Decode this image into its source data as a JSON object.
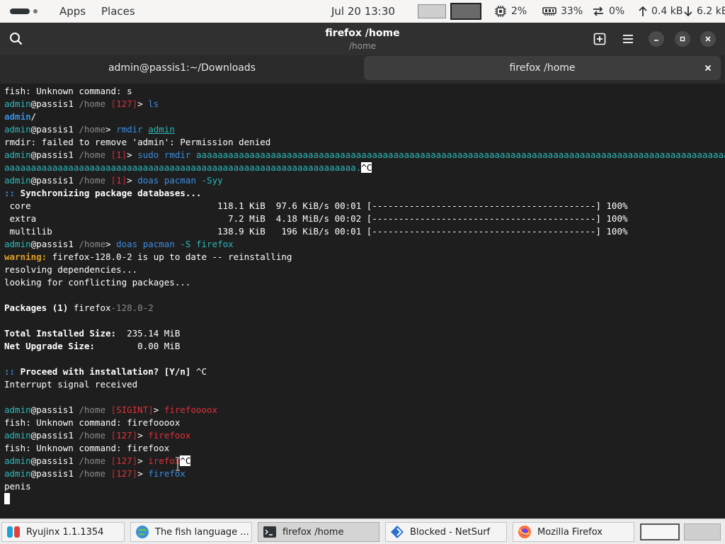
{
  "topbar": {
    "apps": "Apps",
    "places": "Places",
    "clock": "Jul 20  13:30",
    "cpu": "2%",
    "memory": "33%",
    "swap": "0%",
    "upload": "0.4 kB",
    "download": "6.2 kB"
  },
  "header": {
    "title": "firefox /home",
    "subtitle": "/home"
  },
  "tabs": [
    {
      "label": "admin@passis1:~/Downloads"
    },
    {
      "label": "firefox /home"
    }
  ],
  "terminal": {
    "lines": [
      [
        {
          "t": "fish: Unknown command: s"
        }
      ],
      [
        {
          "t": "admin",
          "c": "c-cyan"
        },
        {
          "t": "@passis1 "
        },
        {
          "t": "/home",
          "c": "c-dim"
        },
        {
          "t": " [",
          "c": "c-dimred"
        },
        {
          "t": "127",
          "c": "c-red"
        },
        {
          "t": "]",
          "c": "c-dimred"
        },
        {
          "t": "> "
        },
        {
          "t": "ls",
          "c": "c-blue"
        }
      ],
      [
        {
          "t": "admin",
          "c": "c-blue bold"
        },
        {
          "t": "/"
        }
      ],
      [
        {
          "t": "admin",
          "c": "c-cyan"
        },
        {
          "t": "@passis1 "
        },
        {
          "t": "/home",
          "c": "c-dim"
        },
        {
          "t": "> "
        },
        {
          "t": "rmdir",
          "c": "c-blue"
        },
        {
          "t": " "
        },
        {
          "t": "admin",
          "c": "c-cyan ul"
        }
      ],
      [
        {
          "t": "rmdir: failed to remove 'admin': Permission denied"
        }
      ],
      [
        {
          "t": "admin",
          "c": "c-cyan"
        },
        {
          "t": "@passis1 "
        },
        {
          "t": "/home",
          "c": "c-dim"
        },
        {
          "t": " [",
          "c": "c-dimred"
        },
        {
          "t": "1",
          "c": "c-red"
        },
        {
          "t": "]",
          "c": "c-dimred"
        },
        {
          "t": "> "
        },
        {
          "t": "sudo rmdir",
          "c": "c-blue"
        },
        {
          "t": " aaaaaaaaaaaaaaaaaaaaaaaaaaaaaaaaaaaaaaaaaaaaaaaaaaaaaaaaaaaaaaaaaaaaaaaaaaaaaaaaaaaaaaaaaaaaaaaaaaaaaaa",
          "c": "c-cyan"
        }
      ],
      [
        {
          "t": "aaaaaaaaaaaaaaaaaaaaaaaaaaaaaaaaaaaaaaaaaaaaaaaaaaaaaaaaaaaaaaaaaa.",
          "c": "c-cyan"
        },
        {
          "t": "^C",
          "c": "inv"
        }
      ],
      [
        {
          "t": "admin",
          "c": "c-cyan"
        },
        {
          "t": "@passis1 "
        },
        {
          "t": "/home",
          "c": "c-dim"
        },
        {
          "t": " [",
          "c": "c-dimred"
        },
        {
          "t": "1",
          "c": "c-red"
        },
        {
          "t": "]",
          "c": "c-dimred"
        },
        {
          "t": "> "
        },
        {
          "t": "doas pacman",
          "c": "c-blue"
        },
        {
          "t": " -Syy",
          "c": "c-cyan"
        }
      ],
      [
        {
          "t": "::",
          "c": "c-blue bold"
        },
        {
          "t": " Synchronizing package databases...",
          "c": "bold"
        }
      ],
      [
        {
          "t": " core                                   118.1 KiB  97.6 KiB/s 00:01 [------------------------------------------] 100%"
        }
      ],
      [
        {
          "t": " extra                                    7.2 MiB  4.18 MiB/s 00:02 [------------------------------------------] 100%"
        }
      ],
      [
        {
          "t": " multilib                               138.9 KiB   196 KiB/s 00:01 [------------------------------------------] 100%"
        }
      ],
      [
        {
          "t": "admin",
          "c": "c-cyan"
        },
        {
          "t": "@passis1 "
        },
        {
          "t": "/home",
          "c": "c-dim"
        },
        {
          "t": "> "
        },
        {
          "t": "doas pacman",
          "c": "c-blue"
        },
        {
          "t": " -S firefox",
          "c": "c-cyan"
        }
      ],
      [
        {
          "t": "warning:",
          "c": "c-yellow"
        },
        {
          "t": " firefox-128.0-2 is up to date -- reinstalling"
        }
      ],
      [
        {
          "t": "resolving dependencies..."
        }
      ],
      [
        {
          "t": "looking for conflicting packages..."
        }
      ],
      [
        {
          "t": ""
        }
      ],
      [
        {
          "t": "Packages (1)",
          "c": "bold"
        },
        {
          "t": " firefox"
        },
        {
          "t": "-128.0-2",
          "c": "c-dim"
        }
      ],
      [
        {
          "t": ""
        }
      ],
      [
        {
          "t": "Total Installed Size:",
          "c": "bold"
        },
        {
          "t": "  235.14 MiB"
        }
      ],
      [
        {
          "t": "Net Upgrade Size:",
          "c": "bold"
        },
        {
          "t": "        0.00 MiB"
        }
      ],
      [
        {
          "t": ""
        }
      ],
      [
        {
          "t": "::",
          "c": "c-blue bold"
        },
        {
          "t": " Proceed with installation? [Y/n]",
          "c": "bold"
        },
        {
          "t": " ^C"
        }
      ],
      [
        {
          "t": "Interrupt signal received"
        }
      ],
      [
        {
          "t": ""
        }
      ],
      [
        {
          "t": "admin",
          "c": "c-cyan"
        },
        {
          "t": "@passis1 "
        },
        {
          "t": "/home",
          "c": "c-dim"
        },
        {
          "t": " [",
          "c": "c-dimred"
        },
        {
          "t": "SIGINT",
          "c": "c-red"
        },
        {
          "t": "]",
          "c": "c-dimred"
        },
        {
          "t": "> "
        },
        {
          "t": "firefoooox",
          "c": "c-red"
        }
      ],
      [
        {
          "t": "fish: Unknown command: firefoooox"
        }
      ],
      [
        {
          "t": "admin",
          "c": "c-cyan"
        },
        {
          "t": "@passis1 "
        },
        {
          "t": "/home",
          "c": "c-dim"
        },
        {
          "t": " [",
          "c": "c-dimred"
        },
        {
          "t": "127",
          "c": "c-red"
        },
        {
          "t": "]",
          "c": "c-dimred"
        },
        {
          "t": "> "
        },
        {
          "t": "firefoox",
          "c": "c-red"
        }
      ],
      [
        {
          "t": "fish: Unknown command: firefoox"
        }
      ],
      [
        {
          "t": "admin",
          "c": "c-cyan"
        },
        {
          "t": "@passis1 "
        },
        {
          "t": "/home",
          "c": "c-dim"
        },
        {
          "t": " [",
          "c": "c-dimred"
        },
        {
          "t": "127",
          "c": "c-red"
        },
        {
          "t": "]",
          "c": "c-dimred"
        },
        {
          "t": "> "
        },
        {
          "t": "irefox",
          "c": "c-red"
        },
        {
          "t": "^C",
          "c": "inv"
        }
      ],
      [
        {
          "t": "admin",
          "c": "c-cyan"
        },
        {
          "t": "@passis1 "
        },
        {
          "t": "/home",
          "c": "c-dim"
        },
        {
          "t": " [",
          "c": "c-dimred"
        },
        {
          "t": "127",
          "c": "c-red"
        },
        {
          "t": "]",
          "c": "c-dimred"
        },
        {
          "t": "> "
        },
        {
          "t": "firefox",
          "c": "c-blue"
        }
      ],
      [
        {
          "t": "penis"
        }
      ]
    ]
  },
  "taskbar": {
    "tasks": [
      {
        "label": "Ryujinx 1.1.1354",
        "icon": "ryujinx-icon"
      },
      {
        "label": "The fish language ...",
        "icon": "globe-icon"
      },
      {
        "label": "firefox /home",
        "icon": "terminal-icon"
      },
      {
        "label": "Blocked - NetSurf",
        "icon": "netsurf-icon"
      },
      {
        "label": "Mozilla Firefox",
        "icon": "firefox-icon"
      }
    ]
  },
  "colors": {
    "terminal_bg": "#1e1e1e",
    "header_bg": "#303030",
    "command_blue": "#3a8ce0",
    "argument_cyan": "#2db8b8",
    "error_red": "#e0303a",
    "warning_yellow": "#e0a020"
  }
}
